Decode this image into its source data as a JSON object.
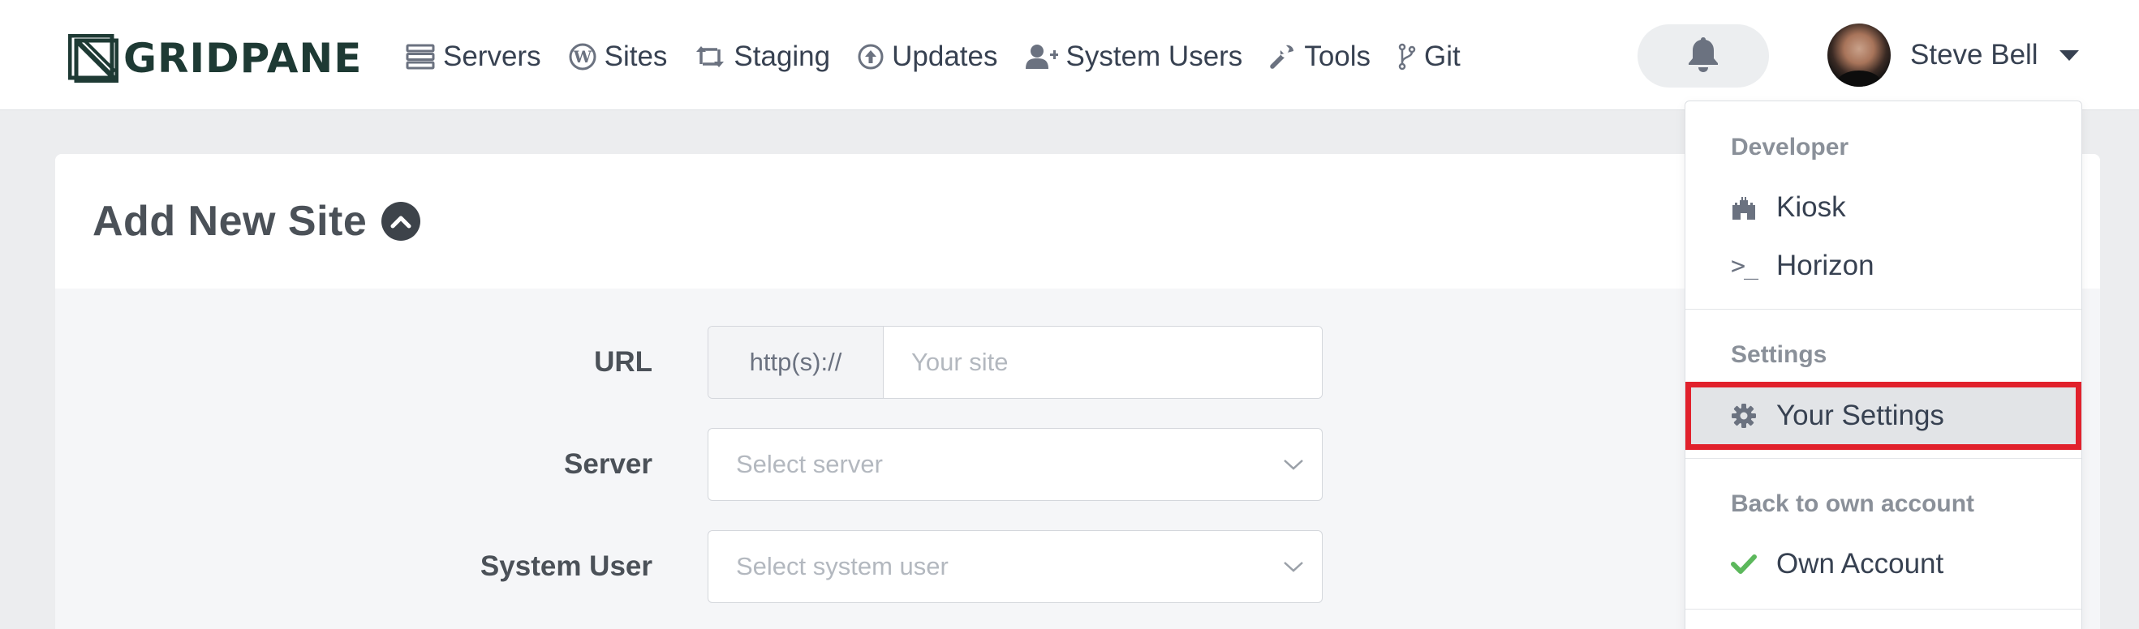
{
  "brand": {
    "name": "GRIDPANE"
  },
  "nav": {
    "items": [
      {
        "label": "Servers",
        "icon": "servers-icon"
      },
      {
        "label": "Sites",
        "icon": "wordpress-icon"
      },
      {
        "label": "Staging",
        "icon": "retweet-icon"
      },
      {
        "label": "Updates",
        "icon": "arrow-up-circle-icon"
      },
      {
        "label": "System Users",
        "icon": "user-plus-icon"
      },
      {
        "label": "Tools",
        "icon": "wrench-icon"
      },
      {
        "label": "Git",
        "icon": "git-branch-icon"
      }
    ]
  },
  "notifications": {
    "icon": "bell-icon"
  },
  "user": {
    "name": "Steve Bell"
  },
  "card": {
    "title": "Add New Site",
    "collapse_icon": "chevron-up-circle-icon"
  },
  "form": {
    "url": {
      "label": "URL",
      "prefix": "http(s)://",
      "placeholder": "Your site",
      "value": ""
    },
    "server": {
      "label": "Server",
      "placeholder": "Select server"
    },
    "system_user": {
      "label": "System User",
      "placeholder": "Select system user"
    }
  },
  "dropdown": {
    "developer_header": "Developer",
    "kiosk_label": "Kiosk",
    "horizon_label": "Horizon",
    "settings_header": "Settings",
    "your_settings_label": "Your Settings",
    "back_header": "Back to own account",
    "own_account_label": "Own Account"
  },
  "colors": {
    "highlight_outline": "#e1212c",
    "check_green": "#5cb85c",
    "brand_dark": "#1e3a34"
  }
}
